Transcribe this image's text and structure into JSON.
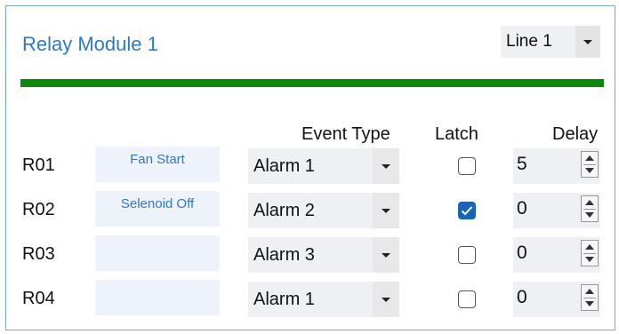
{
  "module": {
    "title": "Relay Module 1",
    "line_select": {
      "value": "Line 1"
    },
    "accent_color": "#0a8a0a",
    "title_color": "#2f78c4"
  },
  "headers": {
    "event_type": "Event Type",
    "latch": "Latch",
    "delay": "Delay"
  },
  "rows": [
    {
      "id": "R01",
      "label": "Fan Start",
      "event": "Alarm 1",
      "latched": false,
      "delay": "5"
    },
    {
      "id": "R02",
      "label": "Selenoid Off",
      "event": "Alarm 2",
      "latched": true,
      "delay": "0"
    },
    {
      "id": "R03",
      "label": "",
      "event": "Alarm 3",
      "latched": false,
      "delay": "0"
    },
    {
      "id": "R04",
      "label": "",
      "event": "Alarm 1",
      "latched": false,
      "delay": "0"
    }
  ]
}
